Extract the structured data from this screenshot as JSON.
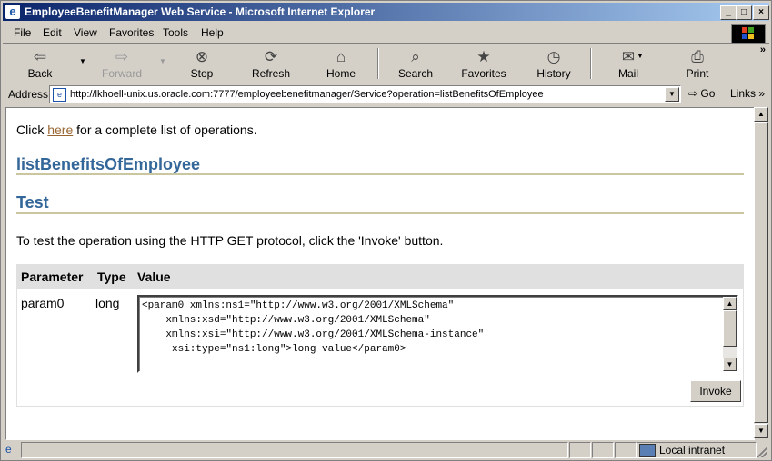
{
  "window": {
    "title": "EmployeeBenefitManager Web Service - Microsoft Internet Explorer",
    "controls": {
      "minimize": "_",
      "maximize": "□",
      "close": "×"
    }
  },
  "menu": [
    "File",
    "Edit",
    "View",
    "Favorites",
    "Tools",
    "Help"
  ],
  "toolbar": {
    "back": "Back",
    "forward": "Forward",
    "stop": "Stop",
    "refresh": "Refresh",
    "home": "Home",
    "search": "Search",
    "favorites": "Favorites",
    "history": "History",
    "mail": "Mail",
    "print": "Print",
    "more": "»"
  },
  "address": {
    "label": "Address",
    "url": "http://lkhoell-unix.us.oracle.com:7777/employeebenefitmanager/Service?operation=listBenefitsOfEmployee",
    "go": "Go",
    "links": "Links »"
  },
  "page": {
    "intro_prefix": "Click ",
    "intro_link": "here",
    "intro_suffix": " for a complete list of operations.",
    "operation_title": "listBenefitsOfEmployee",
    "test_heading": "Test",
    "description": "To test the operation using the HTTP GET protocol, click the 'Invoke' button.",
    "table": {
      "headers": [
        "Parameter",
        "Type",
        "Value"
      ],
      "row": {
        "parameter": "param0",
        "type": "long",
        "value": "<param0 xmlns:ns1=\"http://www.w3.org/2001/XMLSchema\"\n    xmlns:xsd=\"http://www.w3.org/2001/XMLSchema\"\n    xmlns:xsi=\"http://www.w3.org/2001/XMLSchema-instance\"\n     xsi:type=\"ns1:long\">long value</param0>"
      }
    },
    "invoke_button": "Invoke"
  },
  "status": {
    "zone": "Local intranet"
  },
  "colors": {
    "heading": "#336699",
    "link": "#996633",
    "rule": "#c9c6a0"
  }
}
